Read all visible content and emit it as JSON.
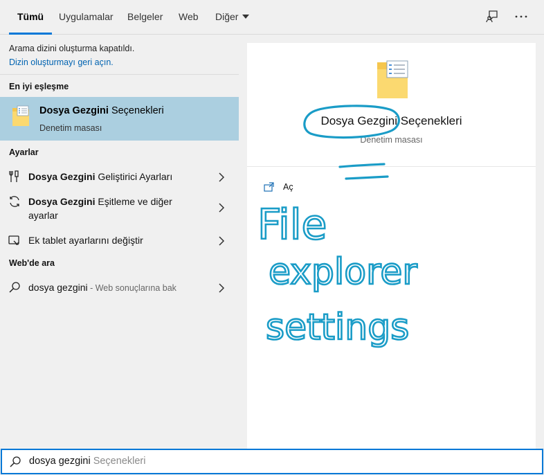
{
  "tabs": [
    {
      "label": "Tümü",
      "active": true
    },
    {
      "label": "Uygulamalar"
    },
    {
      "label": "Belgeler"
    },
    {
      "label": "Web"
    },
    {
      "label": "Diğer"
    }
  ],
  "notice": {
    "text": "Arama dizini oluşturma kapatıldı.",
    "link": "Dizin oluşturmayı geri açın."
  },
  "best_match": {
    "header": "En iyi eşleşme",
    "title_bold": "Dosya Gezgini",
    "title_rest": " Seçenekleri",
    "subtitle": "Denetim masası",
    "icon": "folder-options-icon"
  },
  "settings": {
    "header": "Ayarlar",
    "items": [
      {
        "bold": "Dosya Gezgini",
        "rest": " Geliştirici Ayarları",
        "icon": "developer-tools-icon"
      },
      {
        "bold": "Dosya Gezgini",
        "rest": " Eşitleme ve diğer",
        "line2": "ayarlar",
        "icon": "sync-icon"
      },
      {
        "bold": "",
        "rest": "Ek tablet ayarlarını değiştir",
        "icon": "tablet-icon"
      }
    ]
  },
  "web": {
    "header": "Web'de ara",
    "query": "dosya gezgini",
    "hint": " - Web sonuçlarına bak",
    "icon": "search-icon"
  },
  "preview": {
    "title": "Dosya Gezgini Seçenekleri",
    "subtitle": "Denetim masası",
    "action": "Aç",
    "icon": "folder-options-icon",
    "action_icon": "open-icon"
  },
  "annotation": {
    "text": "File explorer settings",
    "color": "#1a9cc7"
  },
  "search": {
    "value": "dosya gezgini",
    "suggestion": " Seçenekleri"
  },
  "colors": {
    "accent": "#0078d7",
    "selected_bg": "#abcfe0",
    "link": "#0063b1"
  }
}
